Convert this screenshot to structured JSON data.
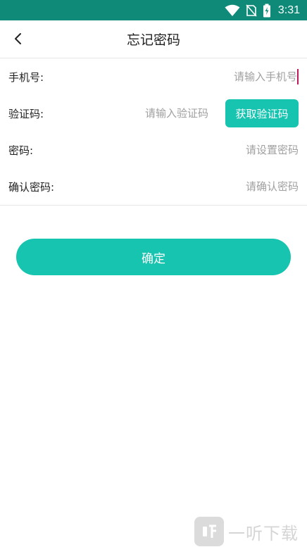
{
  "status_bar": {
    "time": "3:31",
    "icons": [
      "wifi-icon",
      "no-sim-icon",
      "battery-charging-icon"
    ],
    "background": "#0f8a78"
  },
  "header": {
    "title": "忘记密码",
    "back_icon": "chevron-left-icon"
  },
  "form": {
    "phone": {
      "label": "手机号:",
      "placeholder": "请输入手机号"
    },
    "code": {
      "label": "验证码:",
      "placeholder": "请输入验证码",
      "button": "获取验证码"
    },
    "password": {
      "label": "密码:",
      "placeholder": "请设置密码"
    },
    "confirm_password": {
      "label": "确认密码:",
      "placeholder": "请确认密码"
    }
  },
  "confirm_button": "确定",
  "watermark": {
    "text": "一听下载",
    "logo": "listen-logo-icon"
  },
  "colors": {
    "accent": "#16c4b0",
    "status_bar": "#0f8a78",
    "caret": "#c2185b",
    "placeholder": "#a0a0a0"
  }
}
